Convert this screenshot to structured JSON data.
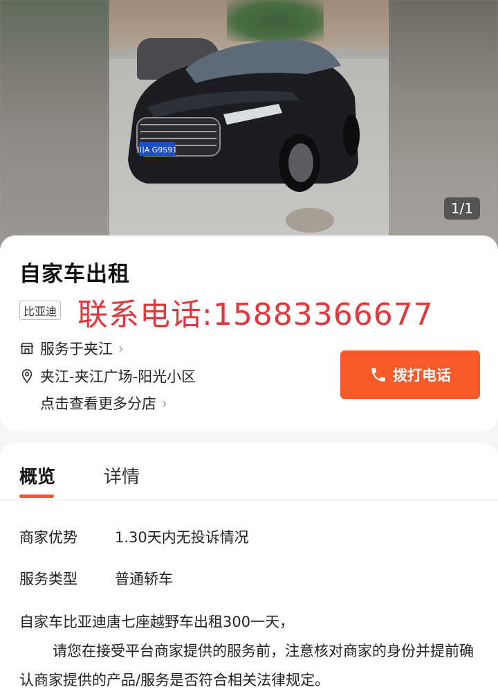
{
  "hero": {
    "counter": "1/1",
    "plate": "川A G9S91"
  },
  "listing": {
    "title": "自家车出租",
    "brand_tag": "比亚迪",
    "phone_line": "联系电话:15883366677",
    "service_area": "服务于夹江",
    "address": "夹江-夹江广场-阳光小区",
    "more_stores": "点击查看更多分店",
    "call_button": "拨打电话"
  },
  "tabs": {
    "overview": "概览",
    "details": "详情"
  },
  "attributes": [
    {
      "key": "商家优势",
      "value": "1.30天内无投诉情况"
    },
    {
      "key": "服务类型",
      "value": "普通轿车"
    }
  ],
  "description": {
    "line1": "自家车比亚迪唐七座越野车出租300一天，",
    "line2": "请您在接受平台商家提供的服务前，注意核对商家的身份并提前确认商家提供的产品/服务是否符合相关法律规定。"
  },
  "colors": {
    "accent": "#f65a2a",
    "phone_red": "#e5363c"
  }
}
